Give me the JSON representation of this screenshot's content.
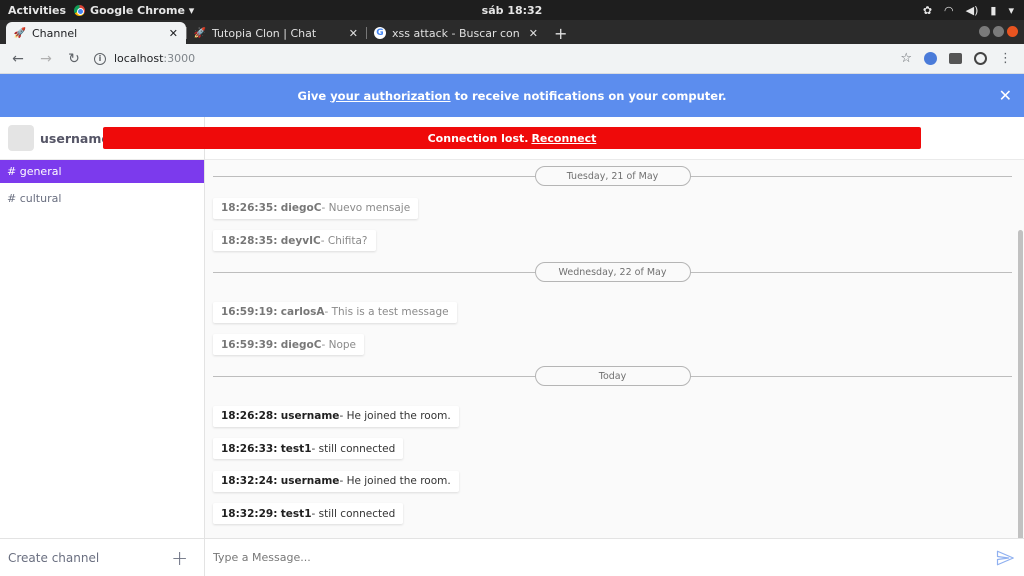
{
  "system_bar": {
    "activities": "Activities",
    "app_name": "Google Chrome ▾",
    "clock": "sáb 18:32"
  },
  "browser": {
    "tabs": [
      {
        "title": "Channel",
        "icon": "rocket-icon",
        "active": true
      },
      {
        "title": "Tutopia Clon | Chat",
        "icon": "rocket-icon",
        "active": false
      },
      {
        "title": "xss attack - Buscar con Goo",
        "icon": "google-icon",
        "active": false
      }
    ],
    "url_host": "localhost",
    "url_port": ":3000"
  },
  "notification": {
    "prefix": "Give ",
    "link": "your authorization",
    "suffix": " to receive notifications on your computer."
  },
  "sidebar": {
    "username": "username",
    "channels": [
      {
        "label": "# general",
        "active": true
      },
      {
        "label": "# cultural",
        "active": false
      }
    ],
    "create_label": "Create channel"
  },
  "connection": {
    "text": "Connection lost.",
    "link": "Reconnect",
    "color": "#ef0a0a"
  },
  "chat": {
    "groups": [
      {
        "date": "Tuesday, 21 of May",
        "messages": [
          {
            "time": "18:26:35:",
            "user": "diegoC",
            "text": " - Nuevo mensaje"
          },
          {
            "time": "18:28:35:",
            "user": "deyvIC",
            "text": " - Chifita?"
          }
        ]
      },
      {
        "date": "Wednesday, 22 of May",
        "messages": [
          {
            "time": "16:59:19:",
            "user": "carlosA",
            "text": " - This is a test message"
          },
          {
            "time": "16:59:39:",
            "user": "diegoC",
            "text": " - Nope"
          }
        ]
      },
      {
        "date": "Today",
        "messages": [
          {
            "time": "18:26:28:",
            "user": "username",
            "text": " - He joined the room."
          },
          {
            "time": "18:26:33:",
            "user": "test1",
            "text": " - still connected"
          },
          {
            "time": "18:32:24:",
            "user": "username",
            "text": " - He joined the room."
          },
          {
            "time": "18:32:29:",
            "user": "test1",
            "text": " - still connected"
          }
        ]
      }
    ],
    "composer_placeholder": "Type a Message..."
  },
  "colors": {
    "accent": "#7c3aed",
    "banner": "#5c8dee",
    "send": "#8fb0f0"
  }
}
